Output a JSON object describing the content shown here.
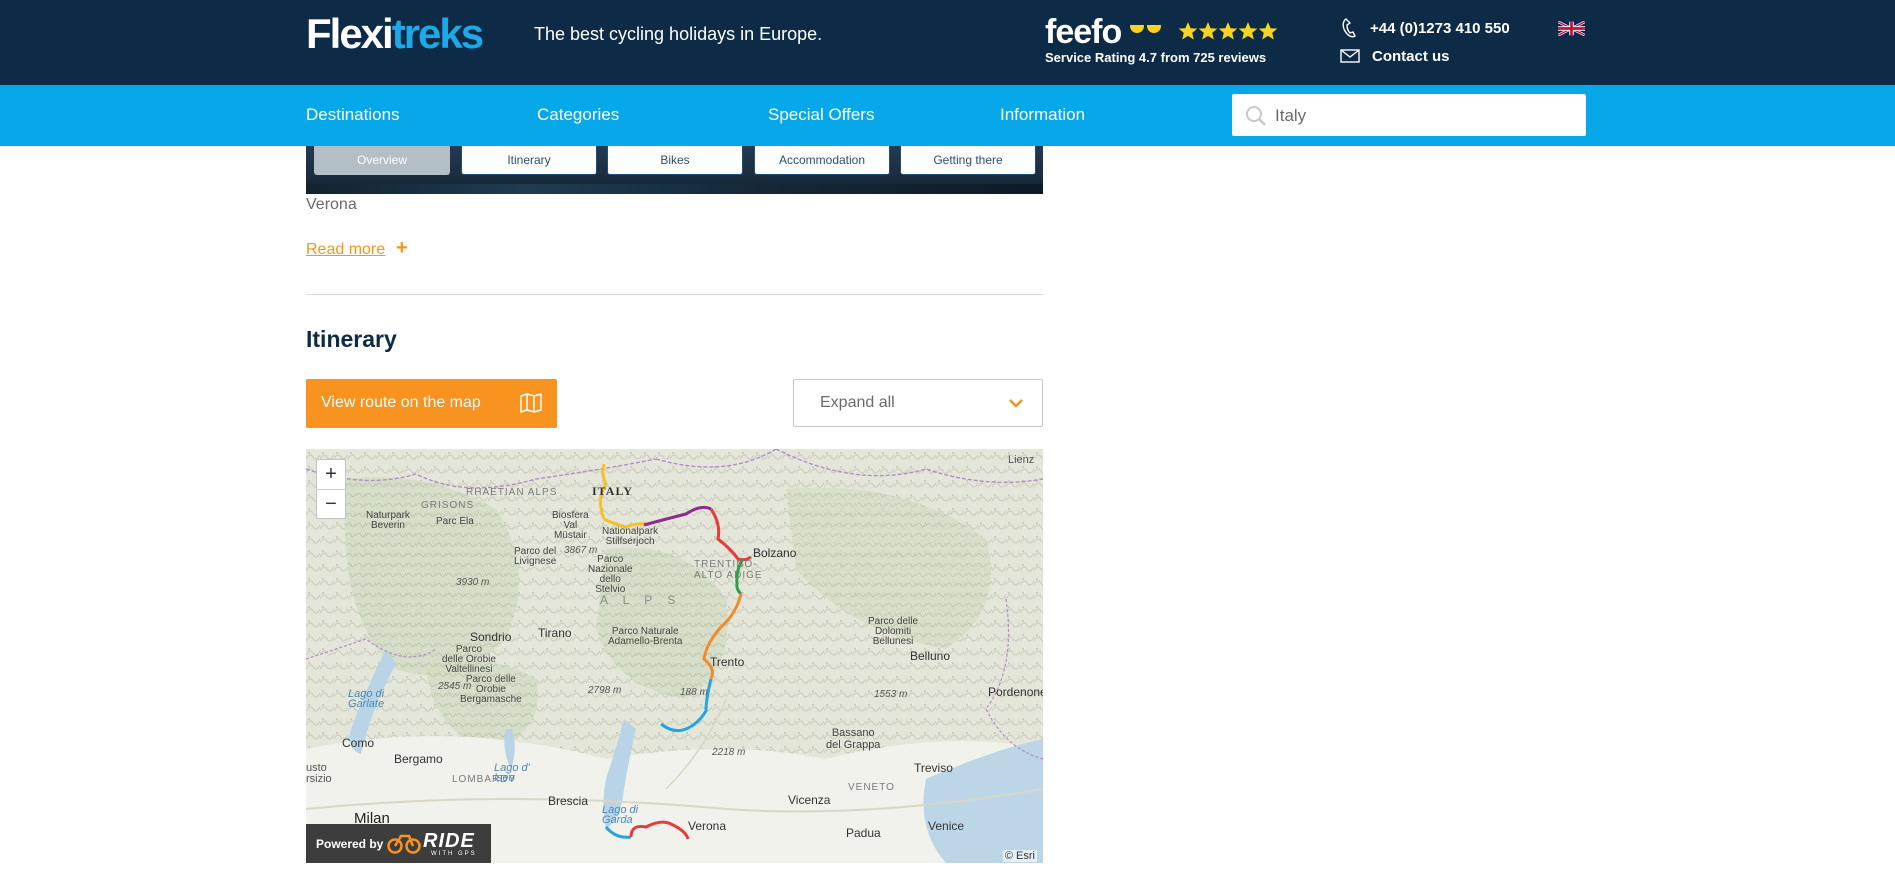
{
  "header": {
    "logo_part1": "Flexi",
    "logo_part2": "treks",
    "tagline": "The best cycling holidays in Europe.",
    "feefo_brand": "feefo",
    "feefo_rating_text": "Service Rating 4.7 from 725 reviews",
    "feefo_stars": 5,
    "phone": "+44 (0)1273 410 550",
    "contact_label": "Contact us",
    "colors": {
      "navy": "#0d2a47",
      "blue": "#07a8ea",
      "accent": "#1ea8e6",
      "star": "#f8d31f"
    }
  },
  "nav": {
    "items": [
      "Destinations",
      "Categories",
      "Special Offers",
      "Information"
    ],
    "search_value": "Italy"
  },
  "tabs": {
    "items": [
      "Overview",
      "Itinerary",
      "Bikes",
      "Accommodation",
      "Getting there"
    ],
    "active": "Overview"
  },
  "overview": {
    "caption": "Verona",
    "read_more": "Read more",
    "read_more_symbol": "+"
  },
  "itinerary": {
    "heading": "Itinerary",
    "route_button": "View route on the map",
    "expand_label": "Expand all",
    "accent": "#f7931e"
  },
  "map": {
    "zoom_in": "+",
    "zoom_out": "−",
    "powered_by": "Powered by",
    "ride_brand": "RIDE",
    "ride_sub": "WITH GPS",
    "attribution": "© Esri",
    "labels": {
      "country": "ITALY",
      "lienz": "Lienz",
      "rhaetian": "RHAETIAN ALPS",
      "grisons": "GRISONS",
      "naturpark": "Naturpark\nBeverin",
      "parc_ela": "Parc Ela",
      "biosfera": "Biosfera\nVal\nMüstair",
      "nationalpark": "Nationalpark\nStilfserjoch",
      "e3867": "3867 m",
      "livignese": "Parco del\nLivignese",
      "stelvio": "Parco\nNazionale\ndello\nStelvio",
      "bolzano": "Bolzano",
      "trentino": "TRENTINO-\nALTO ADIGE",
      "e3930": "3930 m",
      "alps": "A L P S",
      "sondrio": "Sondrio",
      "tirano": "Tirano",
      "adamello": "Parco Naturale\nAdamello-Brenta",
      "dolomiti": "Parco delle\nDolomiti\nBellunesi",
      "orobie_v": "Parco\ndelle Orobie\nValtellinesi",
      "e2545": "2545 m",
      "orobie_b": "Parco delle\nOrobie\nBergamasche",
      "lago_garlate": "Lago di\nGarlate",
      "e2798": "2798 m",
      "trento": "Trento",
      "belluno": "Belluno",
      "e188": "188 m",
      "e1553": "1553 m",
      "pordenone": "Pordenone",
      "como": "Como",
      "bassano": "Bassano\ndel Grappa",
      "e2218": "2218 m",
      "treviso": "Treviso",
      "bergamo": "Bergamo",
      "lombardy": "LOMBARDY",
      "lago_iseo": "Lago d'\nIseo",
      "veneto": "VENETO",
      "brescia": "Brescia",
      "vicenza": "Vicenza",
      "lago_garda": "Lago di\nGarda",
      "verona": "Verona",
      "padua": "Padua",
      "venice": "Venice",
      "milan": "Milan",
      "usto": "usto\nrsizio"
    }
  }
}
